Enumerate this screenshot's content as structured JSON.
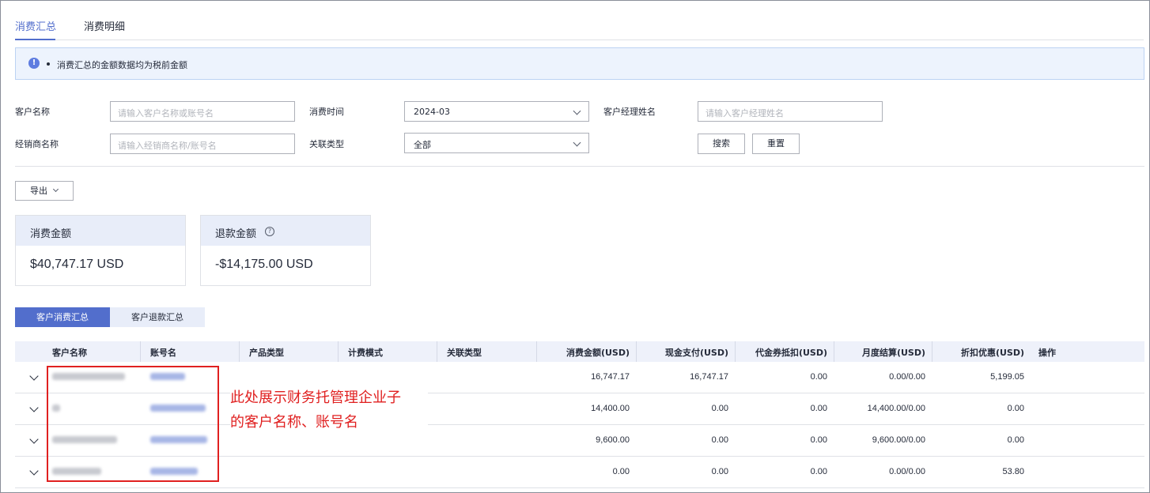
{
  "tabs": [
    {
      "label": "消费汇总",
      "active": true
    },
    {
      "label": "消费明细",
      "active": false
    }
  ],
  "info": {
    "text": "消费汇总的金额数据均为税前金额"
  },
  "filters": {
    "customer_name": {
      "label": "客户名称",
      "placeholder": "请输入客户名称或账号名"
    },
    "consume_time": {
      "label": "消费时间",
      "value": "2024-03"
    },
    "manager_name": {
      "label": "客户经理姓名",
      "placeholder": "请输入客户经理姓名"
    },
    "dealer_name": {
      "label": "经销商名称",
      "placeholder": "请输入经销商名称/账号名"
    },
    "relation_type": {
      "label": "关联类型",
      "value": "全部"
    },
    "search_label": "搜索",
    "reset_label": "重置"
  },
  "export_label": "导出",
  "cards": {
    "consume": {
      "title": "消费金额",
      "value": "$40,747.17 USD"
    },
    "refund": {
      "title": "退款金额",
      "value": "-$14,175.00 USD"
    }
  },
  "segments": {
    "active": "客户消费汇总",
    "inactive": "客户退款汇总"
  },
  "table": {
    "columns": [
      "客户名称",
      "账号名",
      "产品类型",
      "计费模式",
      "关联类型",
      "消费金额(USD)",
      "现金支付(USD)",
      "代金券抵扣(USD)",
      "月度结算(USD)",
      "折扣优惠(USD)",
      "操作"
    ],
    "rows": [
      {
        "consume": "16,747.17",
        "cash": "16,747.17",
        "voucher": "0.00",
        "monthly": "0.00/0.00",
        "discount": "5,199.05"
      },
      {
        "consume": "14,400.00",
        "cash": "0.00",
        "voucher": "0.00",
        "monthly": "14,400.00/0.00",
        "discount": "0.00"
      },
      {
        "consume": "9,600.00",
        "cash": "0.00",
        "voucher": "0.00",
        "monthly": "9,600.00/0.00",
        "discount": "0.00"
      },
      {
        "consume": "0.00",
        "cash": "0.00",
        "voucher": "0.00",
        "monthly": "0.00/0.00",
        "discount": "53.80"
      }
    ]
  },
  "annotation": {
    "line1": "此处展示财务托管理企业子",
    "line2": "的客户名称、账号名"
  },
  "colors": {
    "accent": "#526ecc",
    "annotation": "#e02020",
    "info_bg": "#edf3fd"
  }
}
